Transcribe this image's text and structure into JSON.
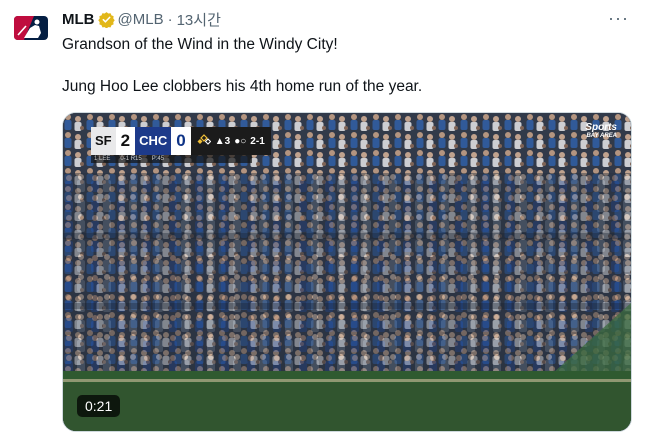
{
  "account": {
    "name": "MLB",
    "handle": "@MLB",
    "separator": "·",
    "time": "13시간"
  },
  "icons": {
    "avatar": "mlb-logo-icon",
    "verified": "verified-badge-icon",
    "more": "more-options-icon"
  },
  "colors": {
    "verified_gold": "#e2b719",
    "mlb_blue": "#041e42",
    "mlb_red": "#bf0d3e"
  },
  "tweet": {
    "line1": "Grandson of the Wind in the Windy City!",
    "line2": "Jung Hoo Lee clobbers his 4th home run of the year."
  },
  "video": {
    "duration": "0:21",
    "scorebug": {
      "away_team": "SF",
      "away_score": "2",
      "home_team": "CHC",
      "home_score": "0",
      "inning": "▲3",
      "count": "2-1",
      "sub_away": "1 LEE",
      "sub_mid": "0-1 R15",
      "sub_right": "P:45"
    },
    "network": "Sports",
    "network_sub": "BAY AREA"
  }
}
